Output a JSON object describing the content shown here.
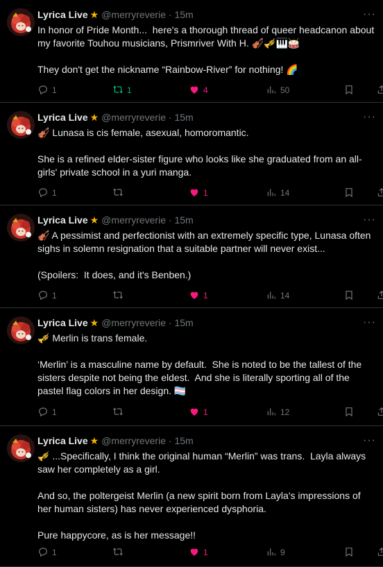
{
  "author": {
    "name": "Lyrica Live",
    "badge_icon": "star-icon",
    "handle": "@merryreverie",
    "separator": "·",
    "time": "15m"
  },
  "more_icon": "more-dots-icon",
  "colors": {
    "background": "#000000",
    "text": "#e7e9ea",
    "muted": "#71767b",
    "divider": "#2f3336",
    "like_active": "#f91880",
    "retweet_active": "#00ba7c",
    "badge": "#f4b400"
  },
  "tweets": [
    {
      "paragraphs": [
        "In honor of Pride Month...  here's a thorough thread of queer headcanon about my favorite Touhou musicians, Prismriver With H. 🎻🎺🎹🥁",
        "They don't get the nickname “Rainbow-River” for nothing! 🌈"
      ],
      "reply_count": "1",
      "retweet_count": "1",
      "like_count": "4",
      "view_count": "50",
      "retweeted": true,
      "liked": true
    },
    {
      "paragraphs": [
        "🎻 Lunasa is cis female, asexual, homoromantic.",
        "She is a refined elder-sister figure who looks like she graduated from an all-girls' private school in a yuri manga."
      ],
      "reply_count": "1",
      "retweet_count": "",
      "like_count": "1",
      "view_count": "14",
      "retweeted": false,
      "liked": true
    },
    {
      "paragraphs": [
        "🎻 A pessimist and perfectionist with an extremely specific type, Lunasa often sighs in solemn resignation that a suitable partner will never exist...",
        "(Spoilers:  It does, and it's Benben.)"
      ],
      "reply_count": "1",
      "retweet_count": "",
      "like_count": "1",
      "view_count": "14",
      "retweeted": false,
      "liked": true
    },
    {
      "paragraphs": [
        "🎺 Merlin is trans female.",
        "‘Merlin’ is a masculine name by default.  She is noted to be the tallest of the sisters despite not being the eldest.  And she is literally sporting all of the pastel flag colors in her design. 🏳️‍⚧️"
      ],
      "reply_count": "1",
      "retweet_count": "",
      "like_count": "1",
      "view_count": "12",
      "retweeted": false,
      "liked": true
    },
    {
      "paragraphs": [
        "🎺 ...Specifically, I think the original human “Merlin” was trans.  Layla always saw her completely as a girl.",
        "And so, the poltergeist Merlin (a new spirit born from Layla's impressions of her human sisters) has never experienced dysphoria.",
        "Pure happycore, as is her message!!"
      ],
      "reply_count": "1",
      "retweet_count": "",
      "like_count": "1",
      "view_count": "9",
      "retweeted": false,
      "liked": true
    }
  ]
}
